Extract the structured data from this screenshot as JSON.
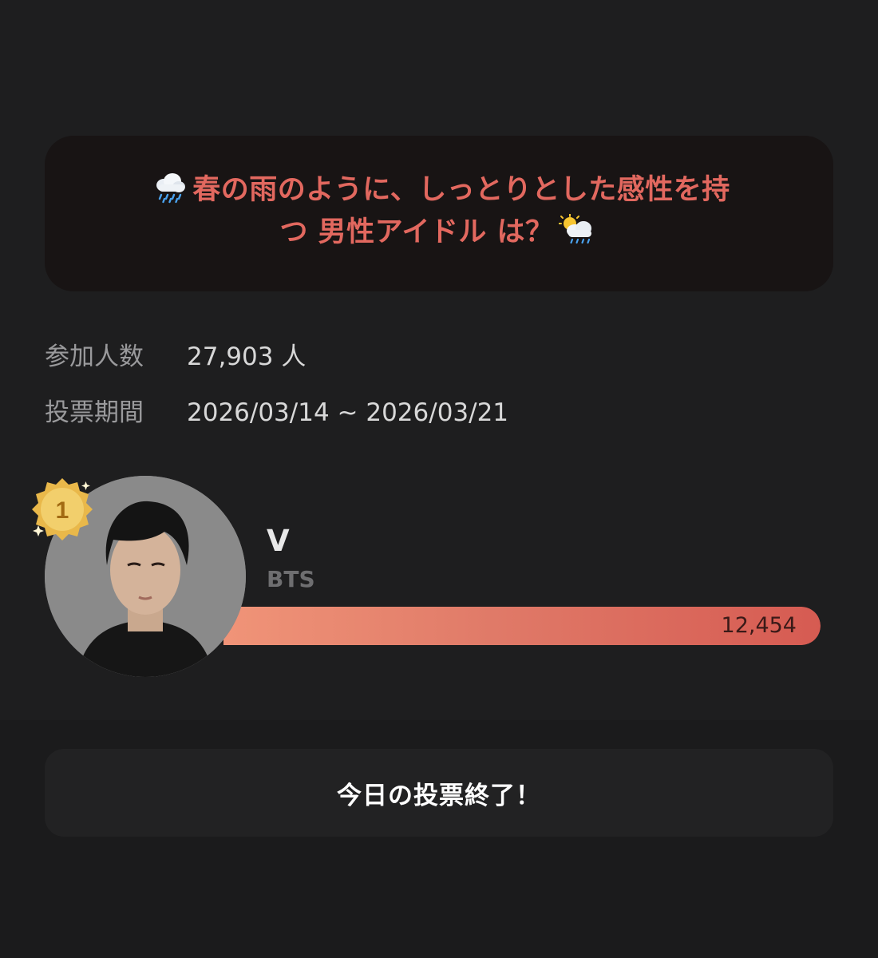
{
  "poll": {
    "question_part1": "春の雨のように、しっとりとした感性を持",
    "question_part2": "つ 男性アイドル は？",
    "icons": {
      "leading": "cloud-with-rain-icon",
      "trailing": "sun-behind-rain-cloud-icon"
    }
  },
  "info": {
    "participants_label": "参加人数",
    "participants_value": "27,903 人",
    "period_label": "投票期間",
    "period_value": "2026/03/14 ~ 2026/03/21"
  },
  "ranking": [
    {
      "rank": "1",
      "name": "V",
      "group": "BTS",
      "votes": "12,454",
      "bar_fraction": 1.0
    }
  ],
  "action": {
    "label": "今日の投票終了！"
  },
  "colors": {
    "background": "#1e1e1f",
    "accent": "#e2685f",
    "bar_start": "#f09478",
    "bar_end": "#d65b52",
    "medal_gold": "#e9b84a"
  }
}
